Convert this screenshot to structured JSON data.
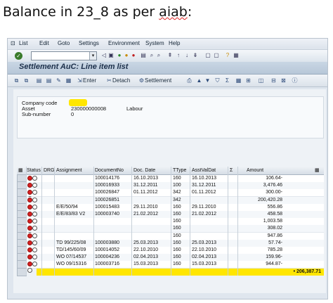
{
  "caption": {
    "prefix": "Balance in 23_8 as per ",
    "underlined": "aiab",
    "suffix": ":"
  },
  "menu": [
    "List",
    "Edit",
    "Goto",
    "Settings",
    "Environment",
    "System",
    "Help"
  ],
  "window": {
    "title": "Settlement AuC: Line item list"
  },
  "toolbar2": {
    "enter_label": "Enter",
    "detach_label": "Detach",
    "settlement_label": "Settlement"
  },
  "header": {
    "company_code_label": "Company code",
    "asset_label": "Asset",
    "asset_value": "230000000008",
    "asset_desc": "Labour",
    "subnumber_label": "Sub-number",
    "subnumber_value": "0"
  },
  "table": {
    "columns": [
      "Status",
      "DRG",
      "Assignment",
      "DocumentNo",
      "Doc. Date",
      "TType",
      "AsstValDat",
      "Σ",
      "Amount"
    ],
    "rows": [
      {
        "assignment": "",
        "docno": "100014176",
        "docdate": "16.10.2013",
        "ttype": "160",
        "asstval": "16.10.2013",
        "amount": "106.64-"
      },
      {
        "assignment": "",
        "docno": "100016933",
        "docdate": "31.12.2011",
        "ttype": "100",
        "asstval": "31.12.2011",
        "amount": "3,476.46"
      },
      {
        "assignment": "",
        "docno": "100026847",
        "docdate": "01.11.2012",
        "ttype": "342",
        "asstval": "01.11.2012",
        "amount": "300.00-"
      },
      {
        "assignment": "",
        "docno": "100026851",
        "docdate": "",
        "ttype": "342",
        "asstval": "",
        "amount": "200,420.28"
      },
      {
        "assignment": "E/E/50/94",
        "docno": "100015483",
        "docdate": "29.11.2010",
        "ttype": "160",
        "asstval": "29.11.2010",
        "amount": "556.86"
      },
      {
        "assignment": "E/E/83/83 V2",
        "docno": "100003740",
        "docdate": "21.02.2012",
        "ttype": "160",
        "asstval": "21.02.2012",
        "amount": "458.58"
      },
      {
        "assignment": "",
        "docno": "",
        "docdate": "",
        "ttype": "160",
        "asstval": "",
        "amount": "1,003.58"
      },
      {
        "assignment": "",
        "docno": "",
        "docdate": "",
        "ttype": "160",
        "asstval": "",
        "amount": "308.02"
      },
      {
        "assignment": "",
        "docno": "",
        "docdate": "",
        "ttype": "160",
        "asstval": "",
        "amount": "947.86"
      },
      {
        "assignment": "TD 99/225/08",
        "docno": "100003880",
        "docdate": "25.03.2013",
        "ttype": "160",
        "asstval": "25.03.2013",
        "amount": "57.74-"
      },
      {
        "assignment": "TD/145/60/09",
        "docno": "100014052",
        "docdate": "22.10.2010",
        "ttype": "160",
        "asstval": "22.10.2010",
        "amount": "785.28"
      },
      {
        "assignment": "WO 07/14537",
        "docno": "100004236",
        "docdate": "02.04.2013",
        "ttype": "160",
        "asstval": "02.04.2013",
        "amount": "159.96-"
      },
      {
        "assignment": "WO 09/15316",
        "docno": "100003716",
        "docdate": "15.03.2013",
        "ttype": "160",
        "asstval": "15.03.2013",
        "amount": "944.87-"
      }
    ],
    "total_marker": "•",
    "total": "206,387.71"
  }
}
